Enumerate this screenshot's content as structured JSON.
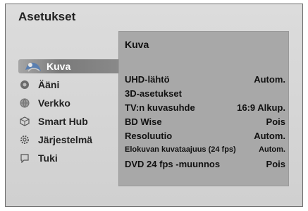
{
  "window": {
    "title": "Asetukset"
  },
  "sidebar": {
    "items": [
      {
        "label": "Kuva",
        "icon": "picture-icon",
        "selected": true
      },
      {
        "label": "Ääni",
        "icon": "sound-icon",
        "selected": false
      },
      {
        "label": "Verkko",
        "icon": "network-icon",
        "selected": false
      },
      {
        "label": "Smart Hub",
        "icon": "smart-hub-icon",
        "selected": false
      },
      {
        "label": "Järjestelmä",
        "icon": "gear-icon",
        "selected": false
      },
      {
        "label": "Tuki",
        "icon": "support-icon",
        "selected": false
      }
    ]
  },
  "panel": {
    "title": "Kuva",
    "rows": [
      {
        "label": "UHD-lähtö",
        "value": "Autom."
      },
      {
        "label": "3D-asetukset",
        "value": ""
      },
      {
        "label": "TV:n kuvasuhde",
        "value": "16:9 Alkup."
      },
      {
        "label": "BD Wise",
        "value": "Pois"
      },
      {
        "label": "Resoluutio",
        "value": "Autom."
      },
      {
        "label": "Elokuvan kuvataajuus (24 fps)",
        "value": "Autom."
      },
      {
        "label": "DVD 24 fps -muunnos",
        "value": "Pois"
      }
    ]
  },
  "colors": {
    "background": "#d6d6d6",
    "panel": "#a8a8a8",
    "selection": "#8a8a8a"
  }
}
